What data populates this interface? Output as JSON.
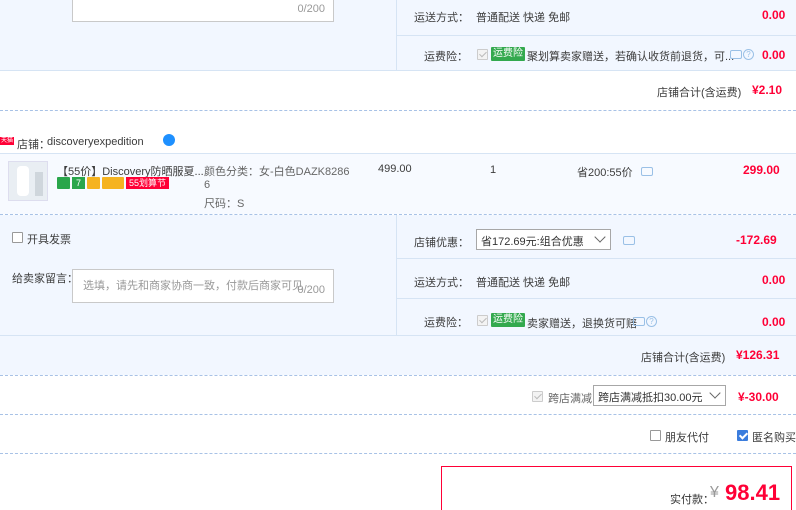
{
  "shop1": {
    "message_count": "0/200",
    "delivery_label": "运送方式：",
    "delivery_value": "普通配送 快递 免邮",
    "delivery_price": "0.00",
    "insurance_label": "运费险：",
    "insurance_tag": "运费险",
    "insurance_desc": "聚划算卖家赠送，若确认收货前退货，可...",
    "insurance_price": "0.00",
    "total_label": "店铺合计(含运费)",
    "total_value": "¥2.10"
  },
  "shop2": {
    "shop_badge": "天猫",
    "shop_label": "店铺：",
    "shop_name": "discoveryexpedition",
    "product": {
      "title": "【55价】Discovery防晒服夏...",
      "badges": [
        "7",
        "55划算节"
      ],
      "color_line1": "颜色分类：女-白色DAZK8286",
      "color_line2": "6",
      "size": "尺码：S",
      "unit_price": "499.00",
      "quantity": "1",
      "discount": "省200:55价",
      "subtotal": "299.00"
    },
    "invoice_label": "开具发票",
    "shop_discount_label": "店铺优惠：",
    "shop_discount_select": "省172.69元:组合优惠",
    "shop_discount_value": "-172.69",
    "message_label": "给卖家留言：",
    "message_placeholder": "选填，请先和商家协商一致，付款后商家可见",
    "message_count": "0/200",
    "delivery_label": "运送方式：",
    "delivery_value": "普通配送 快递 免邮",
    "delivery_price": "0.00",
    "insurance_label": "运费险：",
    "insurance_tag": "运费险",
    "insurance_desc": "卖家赠送，退换货可赔",
    "insurance_price": "0.00",
    "total_label": "店铺合计(含运费)",
    "total_value": "¥126.31"
  },
  "cross_store": {
    "label": "跨店满减",
    "select_value": "跨店满减抵扣30.00元",
    "value": "¥-30.00"
  },
  "options": {
    "friend_pay": "朋友代付",
    "anonymous": "匿名购买"
  },
  "payment": {
    "label": "实付款：",
    "currency": "¥",
    "amount": "98.41"
  },
  "colors": {
    "accent_red": "#ff0036",
    "block_bg": "#f2f7ff",
    "link_blue": "#3b7ddd"
  }
}
